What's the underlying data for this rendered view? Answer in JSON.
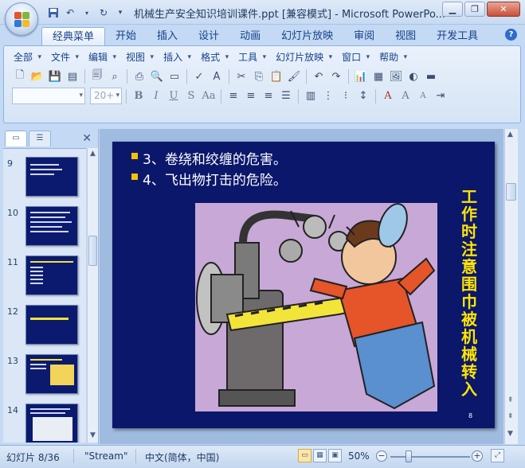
{
  "window": {
    "title": "机械生产安全知识培训课件.ppt [兼容模式] - Microsoft PowerPo...",
    "minimize_icon": "minimize-icon",
    "restore_icon": "restore-icon",
    "close_icon": "close-icon"
  },
  "quick_access": [
    "save-icon",
    "undo-icon",
    "redo-icon",
    "customize-icon"
  ],
  "ribbon": {
    "tabs": [
      "经典菜单",
      "开始",
      "插入",
      "设计",
      "动画",
      "幻灯片放映",
      "审阅",
      "视图",
      "开发工具"
    ],
    "active_tab": "经典菜单",
    "menus": [
      "全部",
      "文件",
      "编辑",
      "视图",
      "插入",
      "格式",
      "工具",
      "幻灯片放映",
      "窗口",
      "帮助"
    ],
    "font_name": "",
    "font_size": "20+"
  },
  "thumbnails": {
    "items": [
      {
        "num": "9"
      },
      {
        "num": "10"
      },
      {
        "num": "11"
      },
      {
        "num": "12"
      },
      {
        "num": "13"
      },
      {
        "num": "14"
      }
    ]
  },
  "slide": {
    "bullets": [
      "3、卷绕和绞缠的危害。",
      "4、飞出物打击的危险。"
    ],
    "vertical_text": "工作时注意围巾被机械转入",
    "page_number": "8",
    "colors": {
      "background": "#0a176b",
      "bullet": "#f3c300",
      "vertical_text": "#ffe500"
    }
  },
  "status": {
    "slide_info": "幻灯片 8/36",
    "theme": "\"Stream\"",
    "language": "中文(简体，中国)",
    "zoom": "50%"
  }
}
